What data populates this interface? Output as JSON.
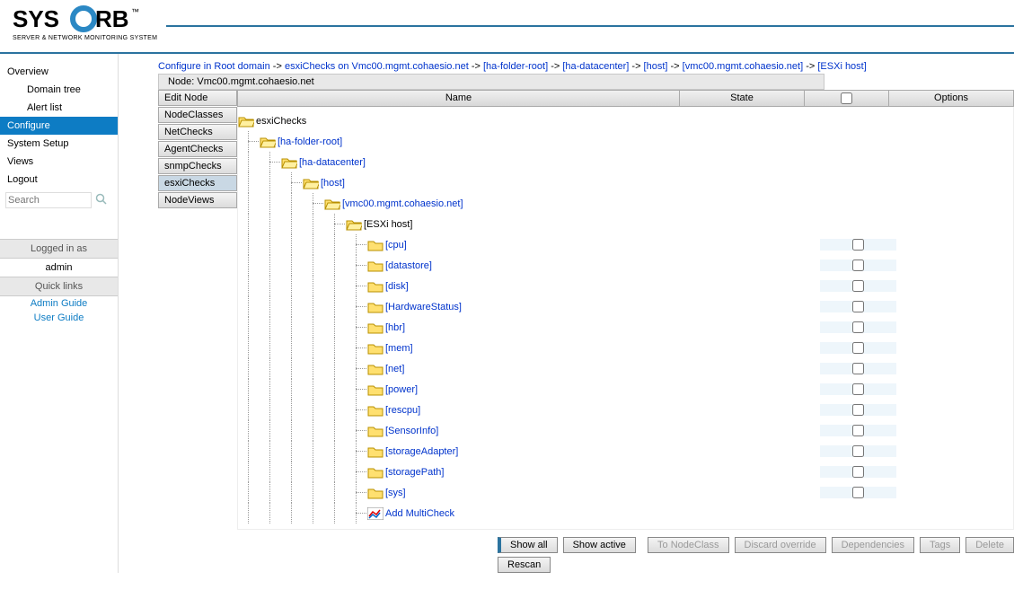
{
  "logo": {
    "brand_pre": "SYS",
    "brand_o": "O",
    "brand_post": "RB",
    "tm": "™",
    "tag": "SERVER & NETWORK MONITORING SYSTEM"
  },
  "nav": {
    "overview": "Overview",
    "domain_tree": "Domain tree",
    "alert_list": "Alert list",
    "configure": "Configure",
    "system_setup": "System Setup",
    "views": "Views",
    "logout": "Logout"
  },
  "search_placeholder": "Search",
  "logged_in_heading": "Logged in as",
  "logged_in_user": "admin",
  "quick_links_heading": "Quick links",
  "quick_links": {
    "admin": "Admin Guide",
    "user": "User Guide"
  },
  "breadcrumb": [
    {
      "text": "Configure in Root domain",
      "link": true
    },
    {
      "text": "esxiChecks on Vmc00.mgmt.cohaesio.net",
      "link": true
    },
    {
      "text": "[ha-folder-root]",
      "link": true
    },
    {
      "text": "[ha-datacenter]",
      "link": true
    },
    {
      "text": "[host]",
      "link": true
    },
    {
      "text": "[vmc00.mgmt.cohaesio.net]",
      "link": true
    },
    {
      "text": "[ESXi host]",
      "link": true
    }
  ],
  "breadcrumb_sep": " -> ",
  "node_title": "Node: Vmc00.mgmt.cohaesio.net",
  "subnav": [
    "Edit Node",
    "NodeClasses",
    "NetChecks",
    "AgentChecks",
    "snmpChecks",
    "esxiChecks",
    "NodeViews"
  ],
  "subnav_selected": 5,
  "columns": {
    "name": "Name",
    "state": "State",
    "options": "Options"
  },
  "tree": [
    {
      "depth": 0,
      "label": "esxiChecks",
      "link": false,
      "open": true,
      "chk": null
    },
    {
      "depth": 1,
      "label": "[ha-folder-root]",
      "link": true,
      "open": true,
      "chk": null
    },
    {
      "depth": 2,
      "label": "[ha-datacenter]",
      "link": true,
      "open": true,
      "chk": null
    },
    {
      "depth": 3,
      "label": "[host]",
      "link": true,
      "open": true,
      "chk": null
    },
    {
      "depth": 4,
      "label": "[vmc00.mgmt.cohaesio.net]",
      "link": true,
      "open": true,
      "chk": null
    },
    {
      "depth": 5,
      "label": "[ESXi host]",
      "link": false,
      "open": true,
      "chk": null
    },
    {
      "depth": 6,
      "label": "[cpu]",
      "link": true,
      "open": false,
      "chk": true
    },
    {
      "depth": 6,
      "label": "[datastore]",
      "link": true,
      "open": false,
      "chk": true
    },
    {
      "depth": 6,
      "label": "[disk]",
      "link": true,
      "open": false,
      "chk": true
    },
    {
      "depth": 6,
      "label": "[HardwareStatus]",
      "link": true,
      "open": false,
      "chk": true
    },
    {
      "depth": 6,
      "label": "[hbr]",
      "link": true,
      "open": false,
      "chk": true
    },
    {
      "depth": 6,
      "label": "[mem]",
      "link": true,
      "open": false,
      "chk": true
    },
    {
      "depth": 6,
      "label": "[net]",
      "link": true,
      "open": false,
      "chk": true
    },
    {
      "depth": 6,
      "label": "[power]",
      "link": true,
      "open": false,
      "chk": true
    },
    {
      "depth": 6,
      "label": "[rescpu]",
      "link": true,
      "open": false,
      "chk": true
    },
    {
      "depth": 6,
      "label": "[SensorInfo]",
      "link": true,
      "open": false,
      "chk": true
    },
    {
      "depth": 6,
      "label": "[storageAdapter]",
      "link": true,
      "open": false,
      "chk": true
    },
    {
      "depth": 6,
      "label": "[storagePath]",
      "link": true,
      "open": false,
      "chk": true
    },
    {
      "depth": 6,
      "label": "[sys]",
      "link": true,
      "open": false,
      "chk": true
    },
    {
      "depth": 6,
      "label": "Add MultiCheck",
      "link": true,
      "open": false,
      "chk": null,
      "icon": "chart"
    }
  ],
  "buttons": {
    "show_all": "Show all",
    "show_active": "Show active",
    "to_nodeclass": "To NodeClass",
    "discard_override": "Discard override",
    "dependencies": "Dependencies",
    "tags": "Tags",
    "delete": "Delete",
    "rescan": "Rescan"
  }
}
